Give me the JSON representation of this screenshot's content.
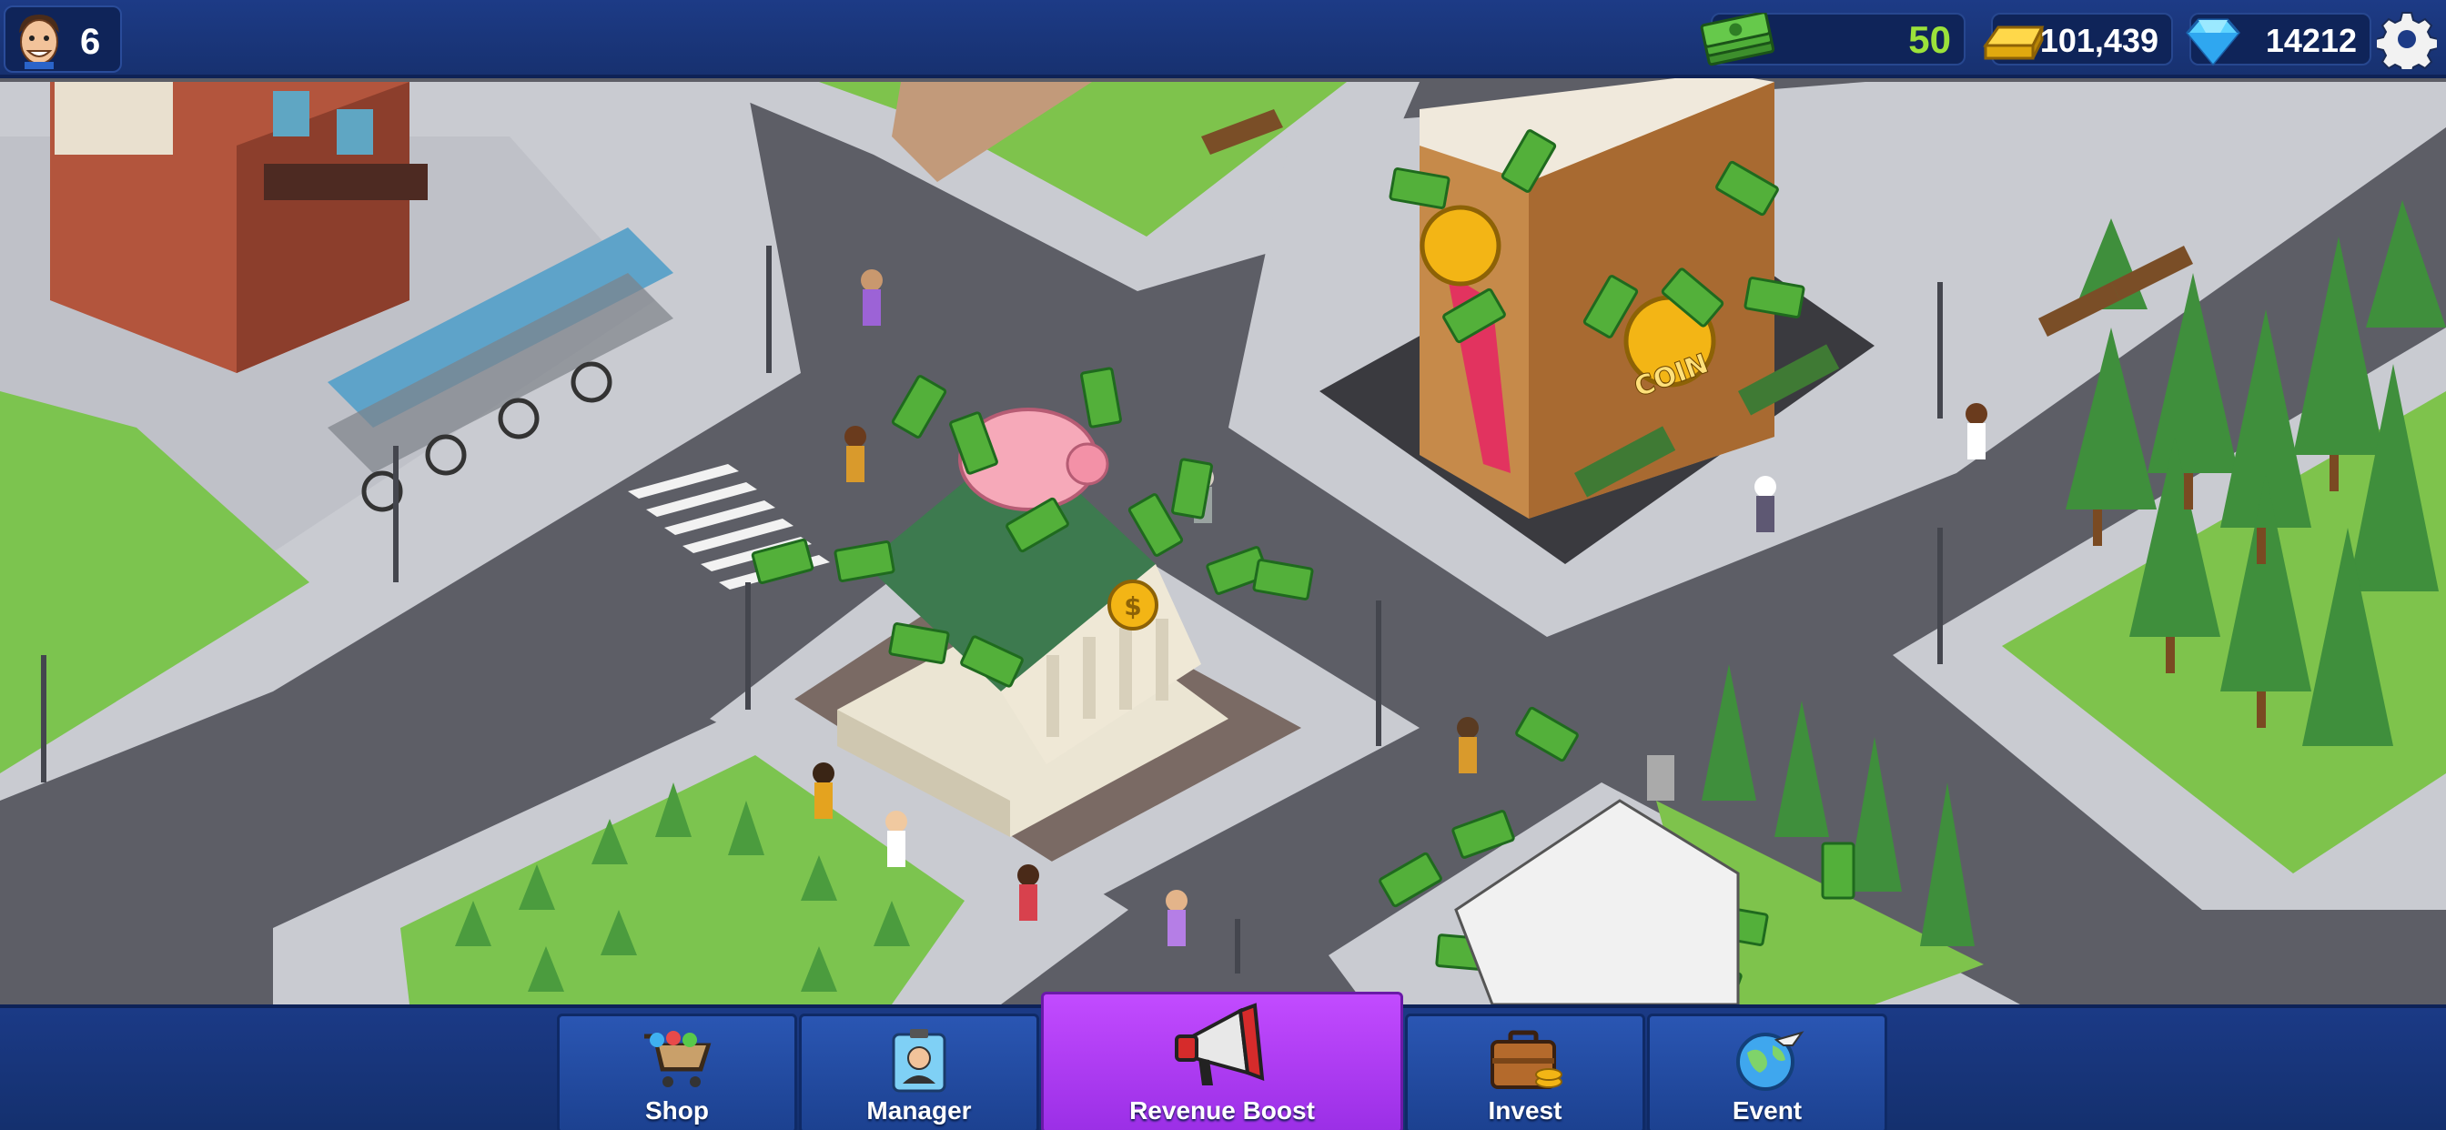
{
  "hud": {
    "player_level": "6",
    "cash": "50",
    "gold": "101,439",
    "gems": "14212"
  },
  "nav": {
    "shop": "Shop",
    "manager": "Manager",
    "revenue_boost": "Revenue Boost",
    "invest": "Invest",
    "event": "Event"
  },
  "map": {
    "coin_sign": "COIN"
  },
  "colors": {
    "cash_text": "#9be23a",
    "active_tab": "#b13ef4",
    "road": "#5a5b63",
    "grass": "#74c24a"
  }
}
